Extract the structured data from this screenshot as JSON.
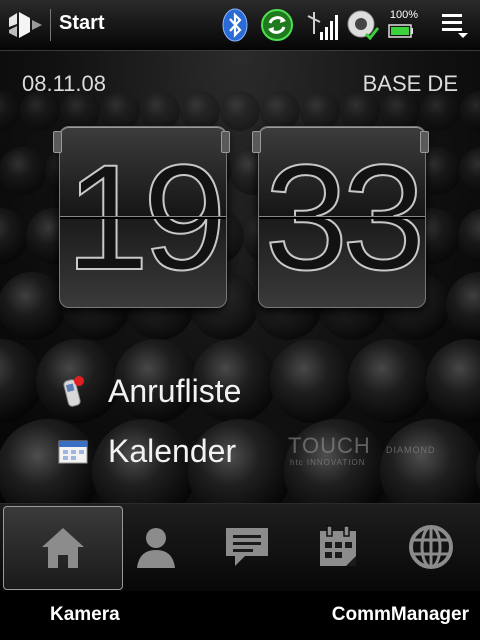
{
  "titlebar": {
    "title": "Start",
    "battery_percent": "100%",
    "icons": [
      "windows-start-icon",
      "bluetooth-icon",
      "sync-icon",
      "signal-icon",
      "volume-icon",
      "battery-icon",
      "menu-icon"
    ]
  },
  "home": {
    "date": "08.11.08",
    "operator": "BASE DE",
    "clock": {
      "hours": "19",
      "minutes": "33"
    },
    "shortcuts": [
      {
        "label": "Anrufliste",
        "icon": "call-history-icon"
      },
      {
        "label": "Kalender",
        "icon": "calendar-icon"
      }
    ],
    "brand": {
      "line1": "TOUCH",
      "line1_suffix": "DIAMOND",
      "line2": "htc INNOVATION"
    }
  },
  "tabs": [
    {
      "icon": "home-icon",
      "selected": true
    },
    {
      "icon": "contact-icon",
      "selected": false
    },
    {
      "icon": "message-icon",
      "selected": false
    },
    {
      "icon": "calendar-icon",
      "selected": false
    },
    {
      "icon": "globe-icon",
      "selected": false
    }
  ],
  "softkeys": {
    "left": "Kamera",
    "right": "CommManager"
  },
  "colors": {
    "background": "#000000",
    "accent_green": "#3bd23b",
    "bluetooth_blue": "#2a6bd6"
  }
}
